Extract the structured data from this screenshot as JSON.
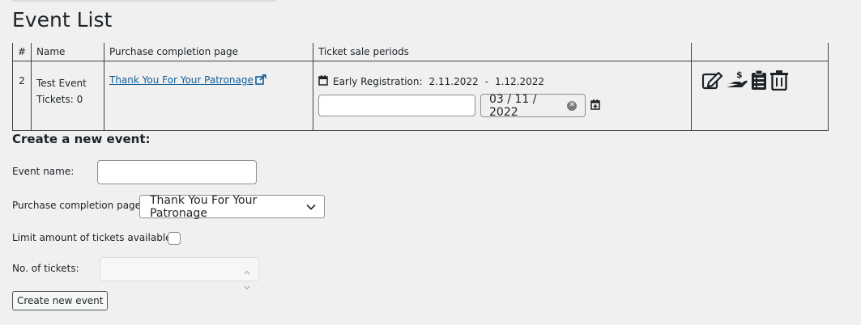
{
  "page": {
    "title": "Event List"
  },
  "table": {
    "headers": [
      "#",
      "Name",
      "Purchase completion page",
      "Ticket sale periods",
      ""
    ],
    "rows": [
      {
        "num": "2",
        "name": "Test Event",
        "tickets": "Tickets: 0",
        "page_link": "Thank You For Your Patronage",
        "period_label": "Early Registration:",
        "period_start": "2.11.2022",
        "period_sep": "-",
        "period_end": "1.12.2022",
        "new_period_name": "",
        "new_period_date": "03 / 11 / 2022"
      }
    ],
    "action_icons": [
      "edit-icon",
      "payment-hand-icon",
      "clipboard-list-icon",
      "trash-icon"
    ]
  },
  "form": {
    "heading": "Create a new event:",
    "event_name_label": "Event name:",
    "event_name_value": "",
    "completion_page_label": "Purchase completion page:",
    "completion_page_value": "Thank You For Your Patronage",
    "limit_label": "Limit amount of tickets available:",
    "limit_checked": false,
    "tickets_label": "No. of tickets:",
    "tickets_value": "",
    "submit_label": "Create new event"
  },
  "colors": {
    "background": "#f0f0f1",
    "link": "#135e96",
    "border": "#3c434a"
  }
}
